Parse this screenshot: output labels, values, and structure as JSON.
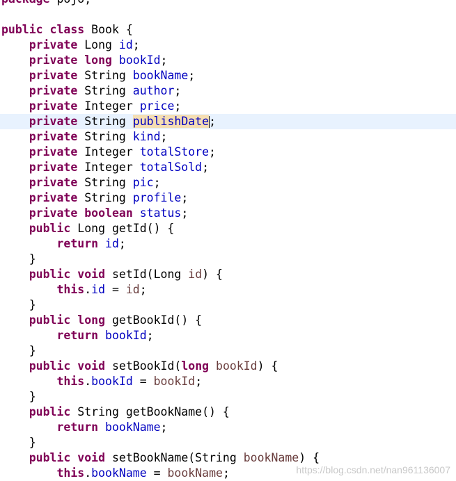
{
  "editor": {
    "current_line_index": 8,
    "lines": [
      [
        {
          "t": "kw",
          "v": "package"
        },
        {
          "t": "plain",
          "v": " pojo;"
        }
      ],
      [],
      [
        {
          "t": "kw",
          "v": "public"
        },
        {
          "t": "plain",
          "v": " "
        },
        {
          "t": "kw",
          "v": "class"
        },
        {
          "t": "plain",
          "v": " Book {"
        }
      ],
      [
        {
          "t": "plain",
          "v": "    "
        },
        {
          "t": "kw",
          "v": "private"
        },
        {
          "t": "plain",
          "v": " Long "
        },
        {
          "t": "fld",
          "v": "id"
        },
        {
          "t": "plain",
          "v": ";"
        }
      ],
      [
        {
          "t": "plain",
          "v": "    "
        },
        {
          "t": "kw",
          "v": "private"
        },
        {
          "t": "plain",
          "v": " "
        },
        {
          "t": "kw",
          "v": "long"
        },
        {
          "t": "plain",
          "v": " "
        },
        {
          "t": "fld",
          "v": "bookId"
        },
        {
          "t": "plain",
          "v": ";"
        }
      ],
      [
        {
          "t": "plain",
          "v": "    "
        },
        {
          "t": "kw",
          "v": "private"
        },
        {
          "t": "plain",
          "v": " String "
        },
        {
          "t": "fld",
          "v": "bookName"
        },
        {
          "t": "plain",
          "v": ";"
        }
      ],
      [
        {
          "t": "plain",
          "v": "    "
        },
        {
          "t": "kw",
          "v": "private"
        },
        {
          "t": "plain",
          "v": " String "
        },
        {
          "t": "fld",
          "v": "author"
        },
        {
          "t": "plain",
          "v": ";"
        }
      ],
      [
        {
          "t": "plain",
          "v": "    "
        },
        {
          "t": "kw",
          "v": "private"
        },
        {
          "t": "plain",
          "v": " Integer "
        },
        {
          "t": "fld",
          "v": "price"
        },
        {
          "t": "plain",
          "v": ";"
        }
      ],
      [
        {
          "t": "plain",
          "v": "    "
        },
        {
          "t": "kw",
          "v": "private"
        },
        {
          "t": "plain",
          "v": " String "
        },
        {
          "t": "fld mark",
          "v": "publishDate"
        },
        {
          "t": "caret",
          "v": ""
        },
        {
          "t": "plain",
          "v": ";"
        }
      ],
      [
        {
          "t": "plain",
          "v": "    "
        },
        {
          "t": "kw",
          "v": "private"
        },
        {
          "t": "plain",
          "v": " String "
        },
        {
          "t": "fld",
          "v": "kind"
        },
        {
          "t": "plain",
          "v": ";"
        }
      ],
      [
        {
          "t": "plain",
          "v": "    "
        },
        {
          "t": "kw",
          "v": "private"
        },
        {
          "t": "plain",
          "v": " Integer "
        },
        {
          "t": "fld",
          "v": "totalStore"
        },
        {
          "t": "plain",
          "v": ";"
        }
      ],
      [
        {
          "t": "plain",
          "v": "    "
        },
        {
          "t": "kw",
          "v": "private"
        },
        {
          "t": "plain",
          "v": " Integer "
        },
        {
          "t": "fld",
          "v": "totalSold"
        },
        {
          "t": "plain",
          "v": ";"
        }
      ],
      [
        {
          "t": "plain",
          "v": "    "
        },
        {
          "t": "kw",
          "v": "private"
        },
        {
          "t": "plain",
          "v": " String "
        },
        {
          "t": "fld",
          "v": "pic"
        },
        {
          "t": "plain",
          "v": ";"
        }
      ],
      [
        {
          "t": "plain",
          "v": "    "
        },
        {
          "t": "kw",
          "v": "private"
        },
        {
          "t": "plain",
          "v": " String "
        },
        {
          "t": "fld",
          "v": "profile"
        },
        {
          "t": "plain",
          "v": ";"
        }
      ],
      [
        {
          "t": "plain",
          "v": "    "
        },
        {
          "t": "kw",
          "v": "private"
        },
        {
          "t": "plain",
          "v": " "
        },
        {
          "t": "kw",
          "v": "boolean"
        },
        {
          "t": "plain",
          "v": " "
        },
        {
          "t": "fld",
          "v": "status"
        },
        {
          "t": "plain",
          "v": ";"
        }
      ],
      [
        {
          "t": "plain",
          "v": "    "
        },
        {
          "t": "kw",
          "v": "public"
        },
        {
          "t": "plain",
          "v": " Long getId() {"
        }
      ],
      [
        {
          "t": "plain",
          "v": "        "
        },
        {
          "t": "kw",
          "v": "return"
        },
        {
          "t": "plain",
          "v": " "
        },
        {
          "t": "fld",
          "v": "id"
        },
        {
          "t": "plain",
          "v": ";"
        }
      ],
      [
        {
          "t": "plain",
          "v": "    }"
        }
      ],
      [
        {
          "t": "plain",
          "v": "    "
        },
        {
          "t": "kw",
          "v": "public"
        },
        {
          "t": "plain",
          "v": " "
        },
        {
          "t": "kw",
          "v": "void"
        },
        {
          "t": "plain",
          "v": " setId(Long "
        },
        {
          "t": "param",
          "v": "id"
        },
        {
          "t": "plain",
          "v": ") {"
        }
      ],
      [
        {
          "t": "plain",
          "v": "        "
        },
        {
          "t": "kw",
          "v": "this"
        },
        {
          "t": "plain",
          "v": "."
        },
        {
          "t": "fld",
          "v": "id"
        },
        {
          "t": "plain",
          "v": " = "
        },
        {
          "t": "param",
          "v": "id"
        },
        {
          "t": "plain",
          "v": ";"
        }
      ],
      [
        {
          "t": "plain",
          "v": "    }"
        }
      ],
      [
        {
          "t": "plain",
          "v": "    "
        },
        {
          "t": "kw",
          "v": "public"
        },
        {
          "t": "plain",
          "v": " "
        },
        {
          "t": "kw",
          "v": "long"
        },
        {
          "t": "plain",
          "v": " getBookId() {"
        }
      ],
      [
        {
          "t": "plain",
          "v": "        "
        },
        {
          "t": "kw",
          "v": "return"
        },
        {
          "t": "plain",
          "v": " "
        },
        {
          "t": "fld",
          "v": "bookId"
        },
        {
          "t": "plain",
          "v": ";"
        }
      ],
      [
        {
          "t": "plain",
          "v": "    }"
        }
      ],
      [
        {
          "t": "plain",
          "v": "    "
        },
        {
          "t": "kw",
          "v": "public"
        },
        {
          "t": "plain",
          "v": " "
        },
        {
          "t": "kw",
          "v": "void"
        },
        {
          "t": "plain",
          "v": " setBookId("
        },
        {
          "t": "kw",
          "v": "long"
        },
        {
          "t": "plain",
          "v": " "
        },
        {
          "t": "param",
          "v": "bookId"
        },
        {
          "t": "plain",
          "v": ") {"
        }
      ],
      [
        {
          "t": "plain",
          "v": "        "
        },
        {
          "t": "kw",
          "v": "this"
        },
        {
          "t": "plain",
          "v": "."
        },
        {
          "t": "fld",
          "v": "bookId"
        },
        {
          "t": "plain",
          "v": " = "
        },
        {
          "t": "param",
          "v": "bookId"
        },
        {
          "t": "plain",
          "v": ";"
        }
      ],
      [
        {
          "t": "plain",
          "v": "    }"
        }
      ],
      [
        {
          "t": "plain",
          "v": "    "
        },
        {
          "t": "kw",
          "v": "public"
        },
        {
          "t": "plain",
          "v": " String getBookName() {"
        }
      ],
      [
        {
          "t": "plain",
          "v": "        "
        },
        {
          "t": "kw",
          "v": "return"
        },
        {
          "t": "plain",
          "v": " "
        },
        {
          "t": "fld",
          "v": "bookName"
        },
        {
          "t": "plain",
          "v": ";"
        }
      ],
      [
        {
          "t": "plain",
          "v": "    }"
        }
      ],
      [
        {
          "t": "plain",
          "v": "    "
        },
        {
          "t": "kw",
          "v": "public"
        },
        {
          "t": "plain",
          "v": " "
        },
        {
          "t": "kw",
          "v": "void"
        },
        {
          "t": "plain",
          "v": " setBookName(String "
        },
        {
          "t": "param",
          "v": "bookName"
        },
        {
          "t": "plain",
          "v": ") {"
        }
      ],
      [
        {
          "t": "plain",
          "v": "        "
        },
        {
          "t": "kw",
          "v": "this"
        },
        {
          "t": "plain",
          "v": "."
        },
        {
          "t": "fld",
          "v": "bookName"
        },
        {
          "t": "plain",
          "v": " = "
        },
        {
          "t": "param",
          "v": "bookName"
        },
        {
          "t": "plain",
          "v": ";"
        }
      ]
    ]
  },
  "watermark": "https://blog.csdn.net/nan961136007",
  "colors": {
    "keyword": "#7f0055",
    "field": "#0000c0",
    "parameter": "#6a3e3e",
    "current_line": "#e8f2fe",
    "occurrence_mark": "#f5deb3"
  }
}
